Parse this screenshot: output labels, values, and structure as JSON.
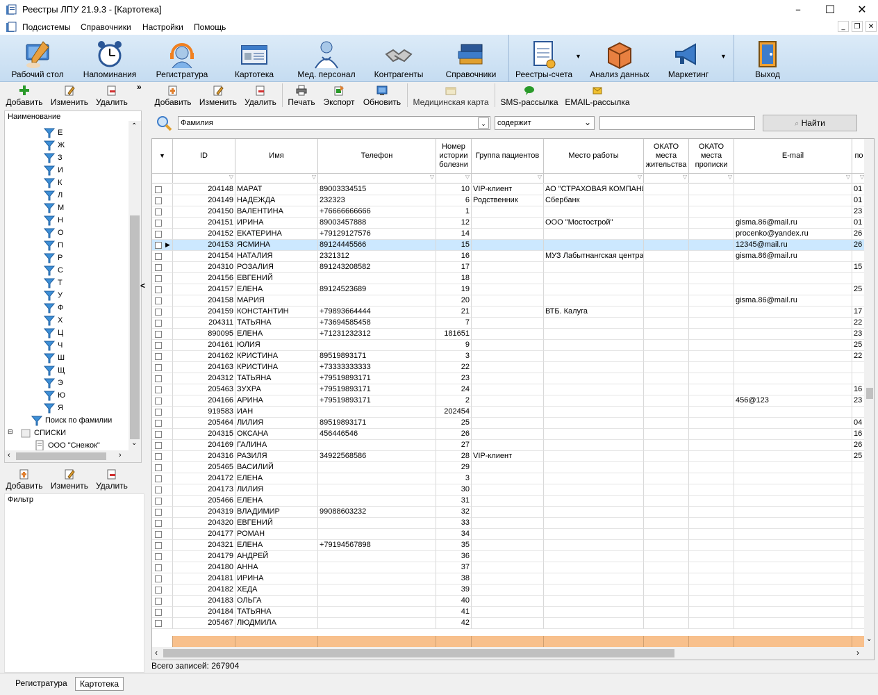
{
  "window": {
    "title": "Реестры ЛПУ 21.9.3 - [Картотека]"
  },
  "menu": [
    "Подсистемы",
    "Справочники",
    "Настройки",
    "Помощь"
  ],
  "ribbon": [
    {
      "label": "Рабочий стол",
      "icon": "desktop-icon"
    },
    {
      "label": "Напоминания",
      "icon": "alarm-clock-icon"
    },
    {
      "label": "Регистратура",
      "icon": "receptionist-icon"
    },
    {
      "label": "Картотека",
      "icon": "card-index-icon"
    },
    {
      "label": "Мед. персонал",
      "icon": "doctor-icon"
    },
    {
      "label": "Контрагенты",
      "icon": "handshake-icon"
    },
    {
      "label": "Справочники",
      "icon": "books-icon"
    },
    {
      "label": "Реестры-счета",
      "icon": "invoice-icon"
    },
    {
      "label": "Анализ данных",
      "icon": "cube-icon"
    },
    {
      "label": "Маркетинг",
      "icon": "megaphone-icon"
    },
    {
      "label": "Выход",
      "icon": "exit-door-icon"
    }
  ],
  "left_toolbar": {
    "add": "Добавить",
    "edit": "Изменить",
    "delete": "Удалить"
  },
  "main_toolbar": {
    "add": "Добавить",
    "edit": "Изменить",
    "delete": "Удалить",
    "print": "Печать",
    "export": "Экспорт",
    "refresh": "Обновить",
    "medcard": "Медицинская карта",
    "sms": "SMS-рассылка",
    "email": "EMAIL-рассылка"
  },
  "tree": {
    "header": "Наименование",
    "letters": [
      "Е",
      "Ж",
      "З",
      "И",
      "К",
      "Л",
      "М",
      "Н",
      "О",
      "П",
      "Р",
      "С",
      "Т",
      "У",
      "Ф",
      "Х",
      "Ц",
      "Ч",
      "Ш",
      "Щ",
      "Э",
      "Ю",
      "Я"
    ],
    "search_by_surname": "Поиск по фамилии",
    "lists": "СПИСКИ",
    "list_item": "ООО \"Снежок\""
  },
  "filter_toolbar": {
    "add": "Добавить",
    "edit": "Изменить",
    "delete": "Удалить"
  },
  "filter_panel": {
    "title": "Фильтр"
  },
  "search": {
    "field": "Фамилия",
    "condition": "содержит",
    "value": "",
    "button": "Найти"
  },
  "grid": {
    "columns": [
      "ID",
      "Имя",
      "Телефон",
      "Номер истории болезни",
      "Группа пациентов",
      "Место работы",
      "ОКАТО места жительства",
      "ОКАТО места прописки",
      "E-mail",
      "по"
    ],
    "rows": [
      [
        "204148",
        "МАРАТ",
        "89003334515",
        "10",
        "VIP-клиент",
        "АО \"СТРАХОВАЯ КОМПАНИЯ",
        "",
        "",
        "",
        "01"
      ],
      [
        "204149",
        "НАДЕЖДА",
        "232323",
        "6",
        "Родственник",
        "Сбербанк",
        "",
        "",
        "",
        "01"
      ],
      [
        "204150",
        "ВАЛЕНТИНА",
        "+76666666666",
        "1",
        "",
        "",
        "",
        "",
        "",
        "23"
      ],
      [
        "204151",
        "ИРИНА",
        "89003457888",
        "12",
        "",
        "ООО \"Мостострой\"",
        "",
        "",
        "gisma.86@mail.ru",
        "01"
      ],
      [
        "204152",
        "ЕКАТЕРИНА",
        "+79129127576",
        "14",
        "",
        "",
        "",
        "",
        "procenko@yandex.ru",
        "26"
      ],
      [
        "204153",
        "ЯСМИНА",
        "89124445566",
        "15",
        "",
        "",
        "",
        "",
        "12345@mail.ru",
        "26"
      ],
      [
        "204154",
        "НАТАЛИЯ",
        "2321312",
        "16",
        "",
        "МУЗ Лабытнангская центра",
        "",
        "",
        "gisma.86@mail.ru",
        ""
      ],
      [
        "204310",
        "РОЗАЛИЯ",
        "891243208582",
        "17",
        "",
        "",
        "",
        "",
        "",
        "15"
      ],
      [
        "204156",
        "ЕВГЕНИЙ",
        "",
        "18",
        "",
        "",
        "",
        "",
        "",
        ""
      ],
      [
        "204157",
        "ЕЛЕНА",
        "89124523689",
        "19",
        "",
        "",
        "",
        "",
        "",
        "25"
      ],
      [
        "204158",
        "МАРИЯ",
        "",
        "20",
        "",
        "",
        "",
        "",
        "gisma.86@mail.ru",
        ""
      ],
      [
        "204159",
        "КОНСТАНТИН",
        "+79893664444",
        "21",
        "",
        "ВТБ. Калуга",
        "",
        "",
        "",
        "17"
      ],
      [
        "204311",
        "ТАТЬЯНА",
        "+73694585458",
        "7",
        "",
        "",
        "",
        "",
        "",
        "22"
      ],
      [
        "890095",
        "ЕЛЕНА",
        "+71231232312",
        "181651",
        "",
        "",
        "",
        "",
        "",
        "23"
      ],
      [
        "204161",
        "ЮЛИЯ",
        "",
        "9",
        "",
        "",
        "",
        "",
        "",
        "25"
      ],
      [
        "204162",
        "КРИСТИНА",
        "89519893171",
        "3",
        "",
        "",
        "",
        "",
        "",
        "22"
      ],
      [
        "204163",
        "КРИСТИНА",
        "+73333333333",
        "22",
        "",
        "",
        "",
        "",
        "",
        ""
      ],
      [
        "204312",
        "ТАТЬЯНА",
        "+79519893171",
        "23",
        "",
        "",
        "",
        "",
        "",
        ""
      ],
      [
        "205463",
        "ЗУХРА",
        "+79519893171",
        "24",
        "",
        "",
        "",
        "",
        "",
        "16"
      ],
      [
        "204166",
        "АРИНА",
        "+79519893171",
        "2",
        "",
        "",
        "",
        "",
        "456@123",
        "23"
      ],
      [
        "919583",
        "ИАН",
        "",
        "202454",
        "",
        "",
        "",
        "",
        "",
        ""
      ],
      [
        "205464",
        "ЛИЛИЯ",
        "89519893171",
        "25",
        "",
        "",
        "",
        "",
        "",
        "04"
      ],
      [
        "204315",
        "ОКСАНА",
        "456446546",
        "26",
        "",
        "",
        "",
        "",
        "",
        "16"
      ],
      [
        "204169",
        "ГАЛИНА",
        "",
        "27",
        "",
        "",
        "",
        "",
        "",
        "26"
      ],
      [
        "204316",
        "РАЗИЛЯ",
        "34922568586",
        "28",
        "VIP-клиент",
        "",
        "",
        "",
        "",
        "25"
      ],
      [
        "205465",
        "ВАСИЛИЙ",
        "",
        "29",
        "",
        "",
        "",
        "",
        "",
        ""
      ],
      [
        "204172",
        "ЕЛЕНА",
        "",
        "3",
        "",
        "",
        "",
        "",
        "",
        ""
      ],
      [
        "204173",
        "ЛИЛИЯ",
        "",
        "30",
        "",
        "",
        "",
        "",
        "",
        ""
      ],
      [
        "205466",
        "ЕЛЕНА",
        "",
        "31",
        "",
        "",
        "",
        "",
        "",
        ""
      ],
      [
        "204319",
        "ВЛАДИМИР",
        "99088603232",
        "32",
        "",
        "",
        "",
        "",
        "",
        ""
      ],
      [
        "204320",
        "ЕВГЕНИЙ",
        "",
        "33",
        "",
        "",
        "",
        "",
        "",
        ""
      ],
      [
        "204177",
        "РОМАН",
        "",
        "34",
        "",
        "",
        "",
        "",
        "",
        ""
      ],
      [
        "204321",
        "ЕЛЕНА",
        "+79194567898",
        "35",
        "",
        "",
        "",
        "",
        "",
        ""
      ],
      [
        "204179",
        "АНДРЕЙ",
        "",
        "36",
        "",
        "",
        "",
        "",
        "",
        ""
      ],
      [
        "204180",
        "АННА",
        "",
        "37",
        "",
        "",
        "",
        "",
        "",
        ""
      ],
      [
        "204181",
        "ИРИНА",
        "",
        "38",
        "",
        "",
        "",
        "",
        "",
        ""
      ],
      [
        "204182",
        "ХЕДА",
        "",
        "39",
        "",
        "",
        "",
        "",
        "",
        ""
      ],
      [
        "204183",
        "ОЛЬГА",
        "",
        "40",
        "",
        "",
        "",
        "",
        "",
        ""
      ],
      [
        "204184",
        "ТАТЬЯНА",
        "",
        "41",
        "",
        "",
        "",
        "",
        "",
        ""
      ],
      [
        "205467",
        "ЛЮДМИЛА",
        "",
        "42",
        "",
        "",
        "",
        "",
        "",
        ""
      ]
    ],
    "selected_row": 5
  },
  "status": {
    "total": "Всего записей: 267904"
  },
  "tabs": [
    "Регистратура",
    "Картотека"
  ],
  "colors": {
    "ribbon": "#c5dcf1",
    "selection": "#cce8ff",
    "footer": "#f8c08c"
  }
}
